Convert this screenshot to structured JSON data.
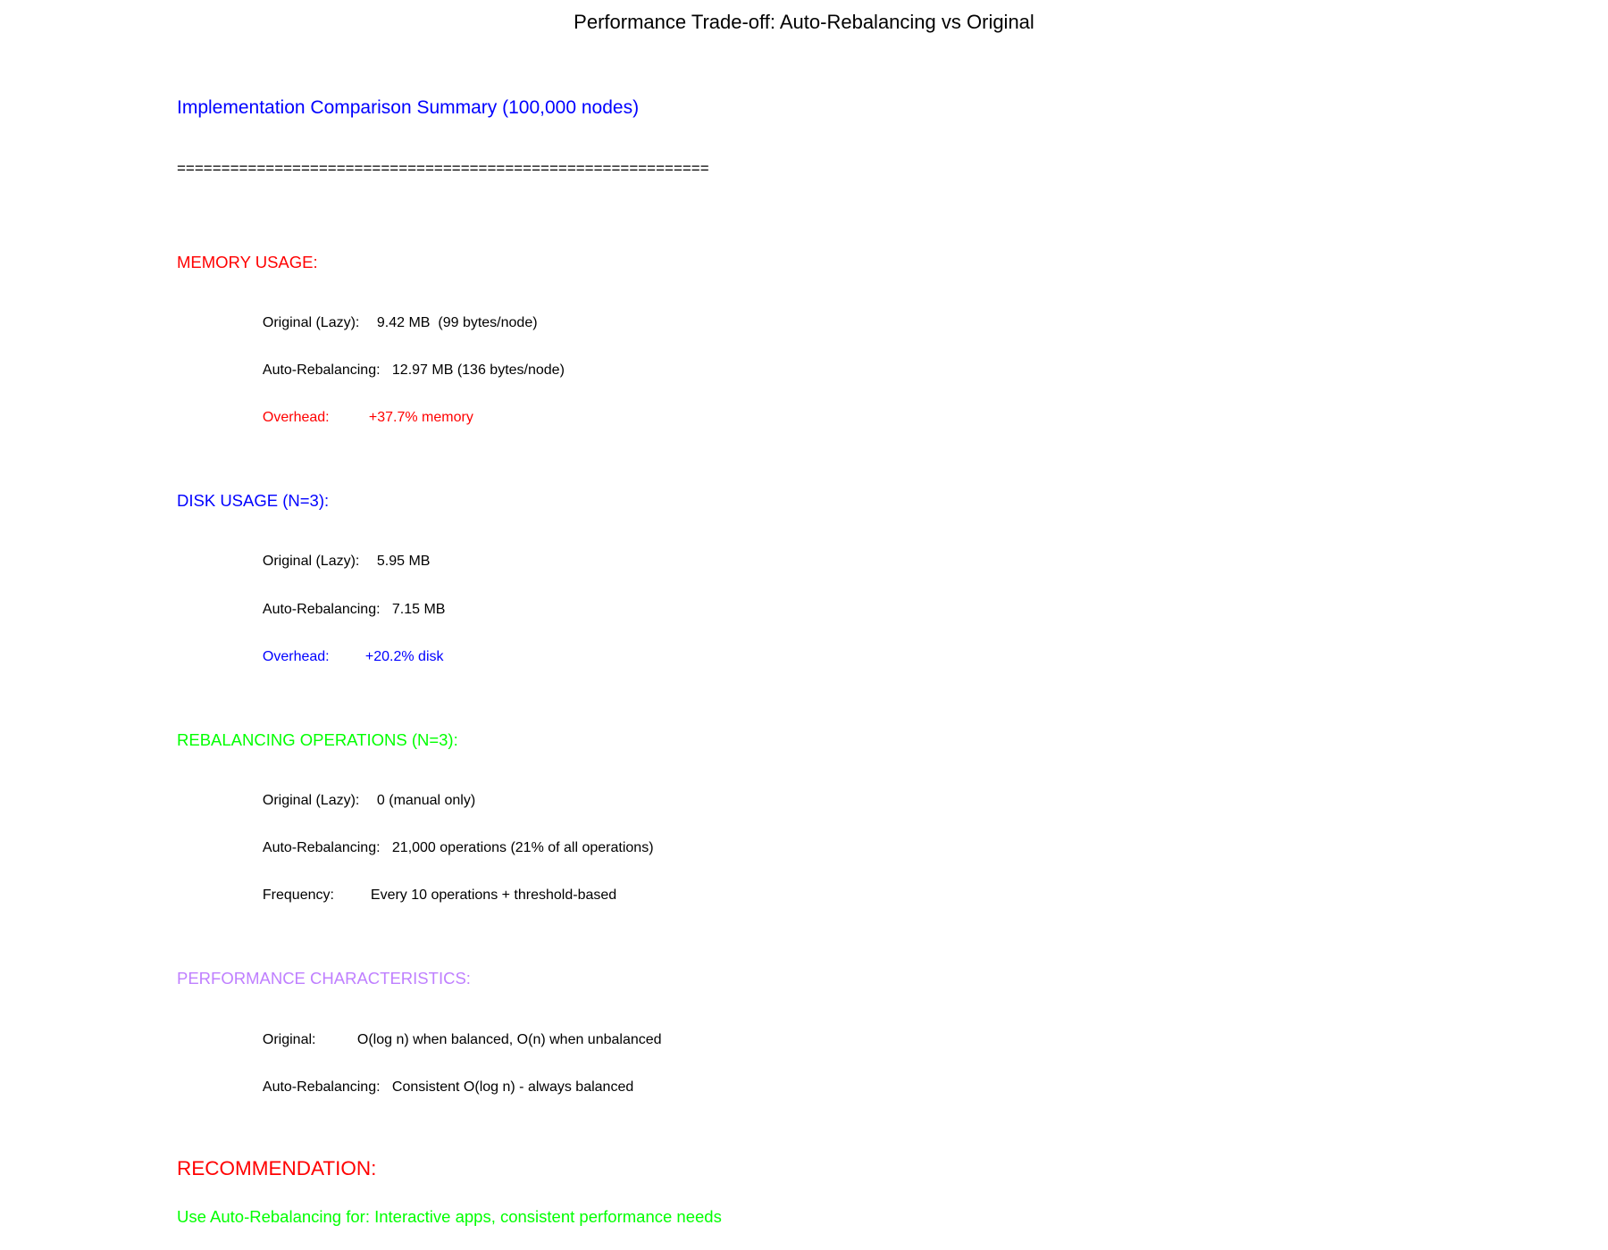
{
  "title": "Performance Trade-off: Auto-Rebalancing vs Original",
  "summary_title": "Implementation Comparison Summary (100,000 nodes)",
  "separator": "============================================================",
  "colors": {
    "title": "#000000",
    "summary": "#0000ff",
    "memory": "#ff0000",
    "disk": "#0000ff",
    "rebalancing": "#00ff00",
    "performance": "#bf7fff",
    "recommendation_heading": "#ff0000",
    "recommendation_text": "#00ff00"
  },
  "sections": {
    "memory": {
      "heading": "MEMORY USAGE:",
      "rows": [
        {
          "label": "Original (Lazy):",
          "value": "9.42 MB  (99 bytes/node)"
        },
        {
          "label": "Auto-Rebalancing:",
          "value": "12.97 MB (136 bytes/node)"
        },
        {
          "label": "Overhead:",
          "value": "+37.7% memory"
        }
      ]
    },
    "disk": {
      "heading": "DISK USAGE (N=3):",
      "rows": [
        {
          "label": "Original (Lazy):",
          "value": "5.95 MB"
        },
        {
          "label": "Auto-Rebalancing:",
          "value": "7.15 MB"
        },
        {
          "label": "Overhead:",
          "value": "+20.2% disk"
        }
      ]
    },
    "rebalancing": {
      "heading": "REBALANCING OPERATIONS (N=3):",
      "rows": [
        {
          "label": "Original (Lazy):",
          "value": "0 (manual only)"
        },
        {
          "label": "Auto-Rebalancing:",
          "value": "21,000 operations (21% of all operations)"
        },
        {
          "label": "Frequency:",
          "value": "Every 10 operations + threshold-based"
        }
      ]
    },
    "performance": {
      "heading": "PERFORMANCE CHARACTERISTICS:",
      "rows": [
        {
          "label": "Original:",
          "value": "O(log n) when balanced, O(n) when unbalanced"
        },
        {
          "label": "Auto-Rebalancing:",
          "value": "Consistent O(log n) - always balanced"
        }
      ]
    }
  },
  "recommendation": {
    "heading": "RECOMMENDATION:",
    "text": "Use Auto-Rebalancing for: Interactive apps, consistent performance needs"
  }
}
